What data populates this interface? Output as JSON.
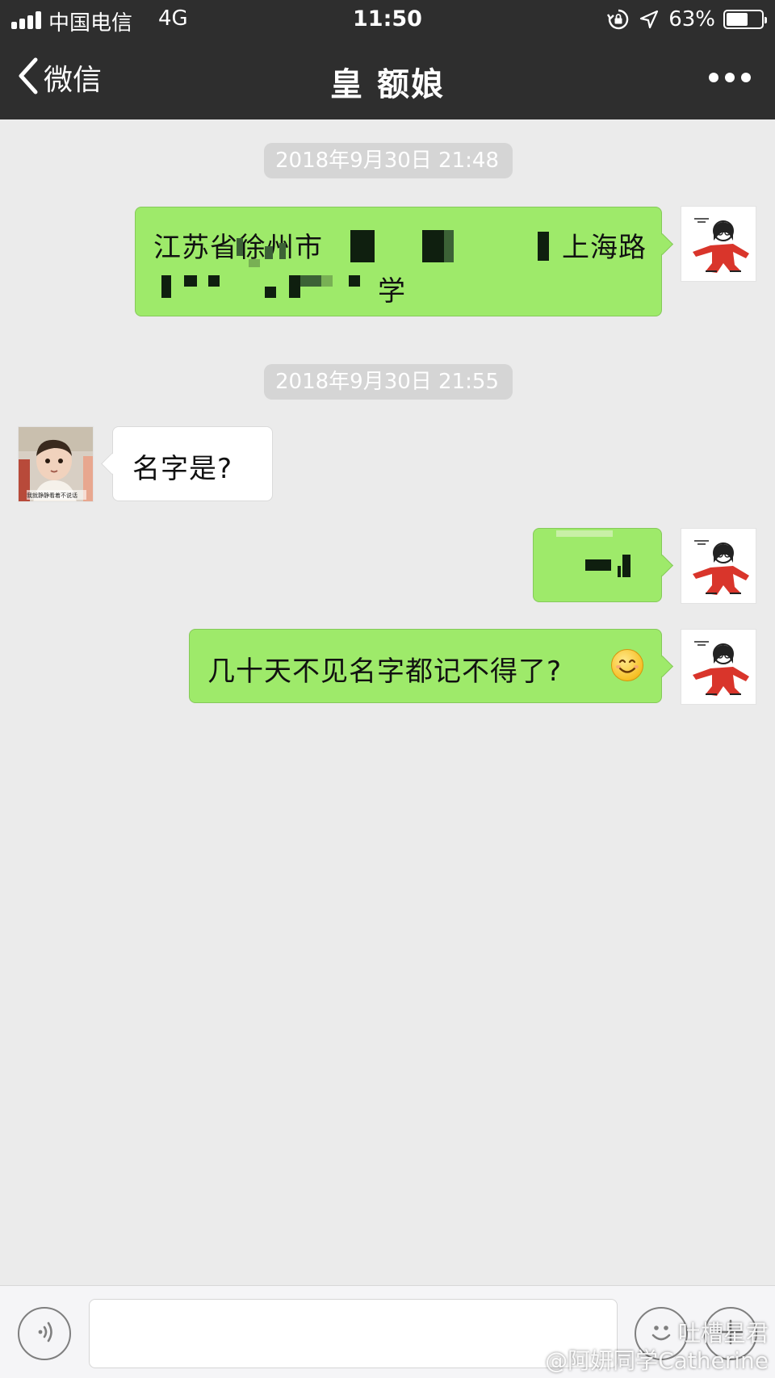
{
  "status_bar": {
    "carrier": "中国电信",
    "network": "4G",
    "time": "11:50",
    "battery_percent": "63%",
    "battery_level": 0.63,
    "icons": [
      "signal-icon",
      "rotation-lock-icon",
      "location-icon",
      "battery-icon"
    ]
  },
  "nav": {
    "back_label": "微信",
    "title": "皇  额娘",
    "more_icon": "more-icon"
  },
  "chat": {
    "timestamps": [
      "2018年9月30日 21:48",
      "2018年9月30日 21:55"
    ],
    "messages": [
      {
        "sender": "me",
        "line1_start": "江苏省徐州市",
        "line1_end": "上海路",
        "line2_end": "学",
        "redacted": true
      },
      {
        "sender": "them",
        "text": "名字是?"
      },
      {
        "sender": "me",
        "redacted": true
      },
      {
        "sender": "me",
        "text": "几十天不见名字都记不得了?",
        "emoji": "smile-emoji"
      }
    ],
    "avatar_caption": "我就静静看着不说话"
  },
  "input_bar": {
    "voice_icon": "voice-icon",
    "emoji_icon": "emoji-icon",
    "plus_icon": "plus-icon"
  },
  "watermark": {
    "line1": "吐槽星君",
    "line2": "@阿妍同学Catherine"
  },
  "colors": {
    "header_bg": "#2e2e2e",
    "chat_bg": "#ebebeb",
    "my_bubble": "#9eea6a",
    "their_bubble": "#ffffff",
    "timestamp_chip": "#d5d5d5"
  }
}
